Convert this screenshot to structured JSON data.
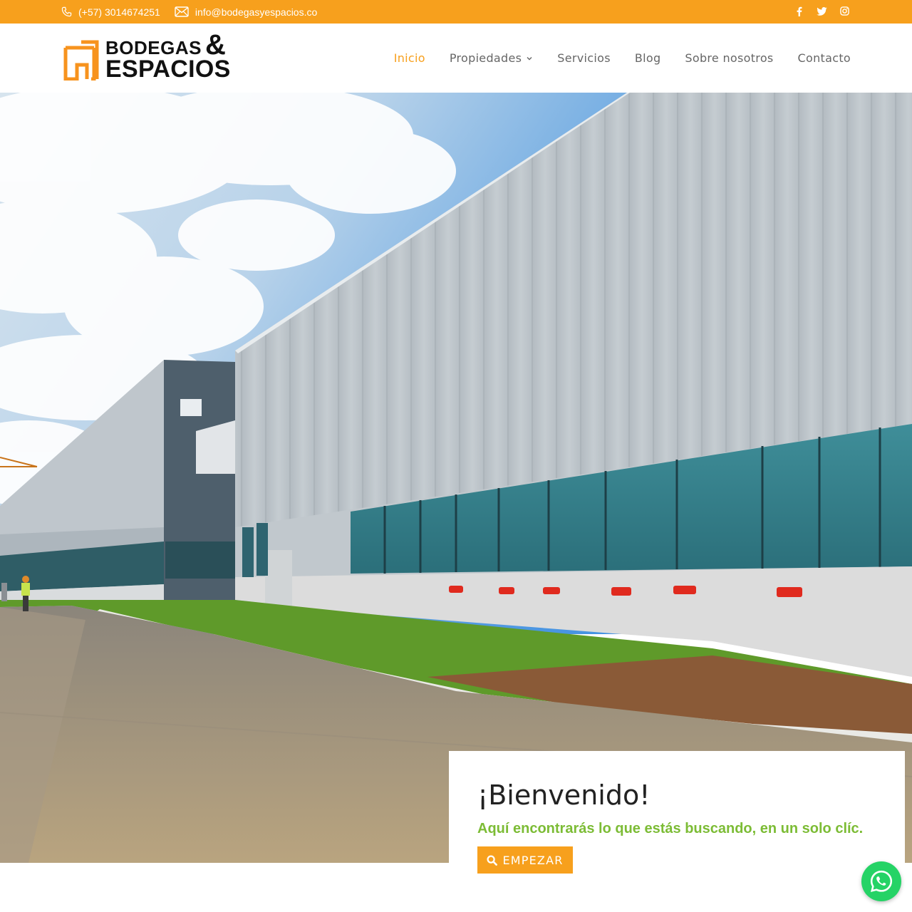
{
  "topbar": {
    "phone": "(+57) 3014674251",
    "email": "info@bodegasyespacios.co",
    "phone_icon": "phone-icon",
    "email_icon": "envelope-icon",
    "social": [
      "facebook-icon",
      "twitter-icon",
      "instagram-icon"
    ],
    "background": "#f7a01d"
  },
  "header": {
    "logo": {
      "line1": "BODEGAS",
      "amp": "&",
      "line2": "ESPACIOS"
    },
    "nav": [
      {
        "label": "Inicio",
        "active": true
      },
      {
        "label": "Propiedades",
        "has_dropdown": true
      },
      {
        "label": "Servicios"
      },
      {
        "label": "Blog"
      },
      {
        "label": "Sobre nosotros"
      },
      {
        "label": "Contacto"
      }
    ]
  },
  "welcome": {
    "title": "¡Bienvenido!",
    "subtitle": "Aquí encontrarás lo que estás buscando, en un solo clíc.",
    "button_label": "EMPEZAR",
    "button_icon": "search-icon"
  },
  "colors": {
    "accent": "#f7a01d",
    "subtitle_green": "#7cbc35",
    "nav_text": "#666666",
    "whatsapp": "#25d366"
  },
  "floating": {
    "icon": "whatsapp-icon"
  }
}
